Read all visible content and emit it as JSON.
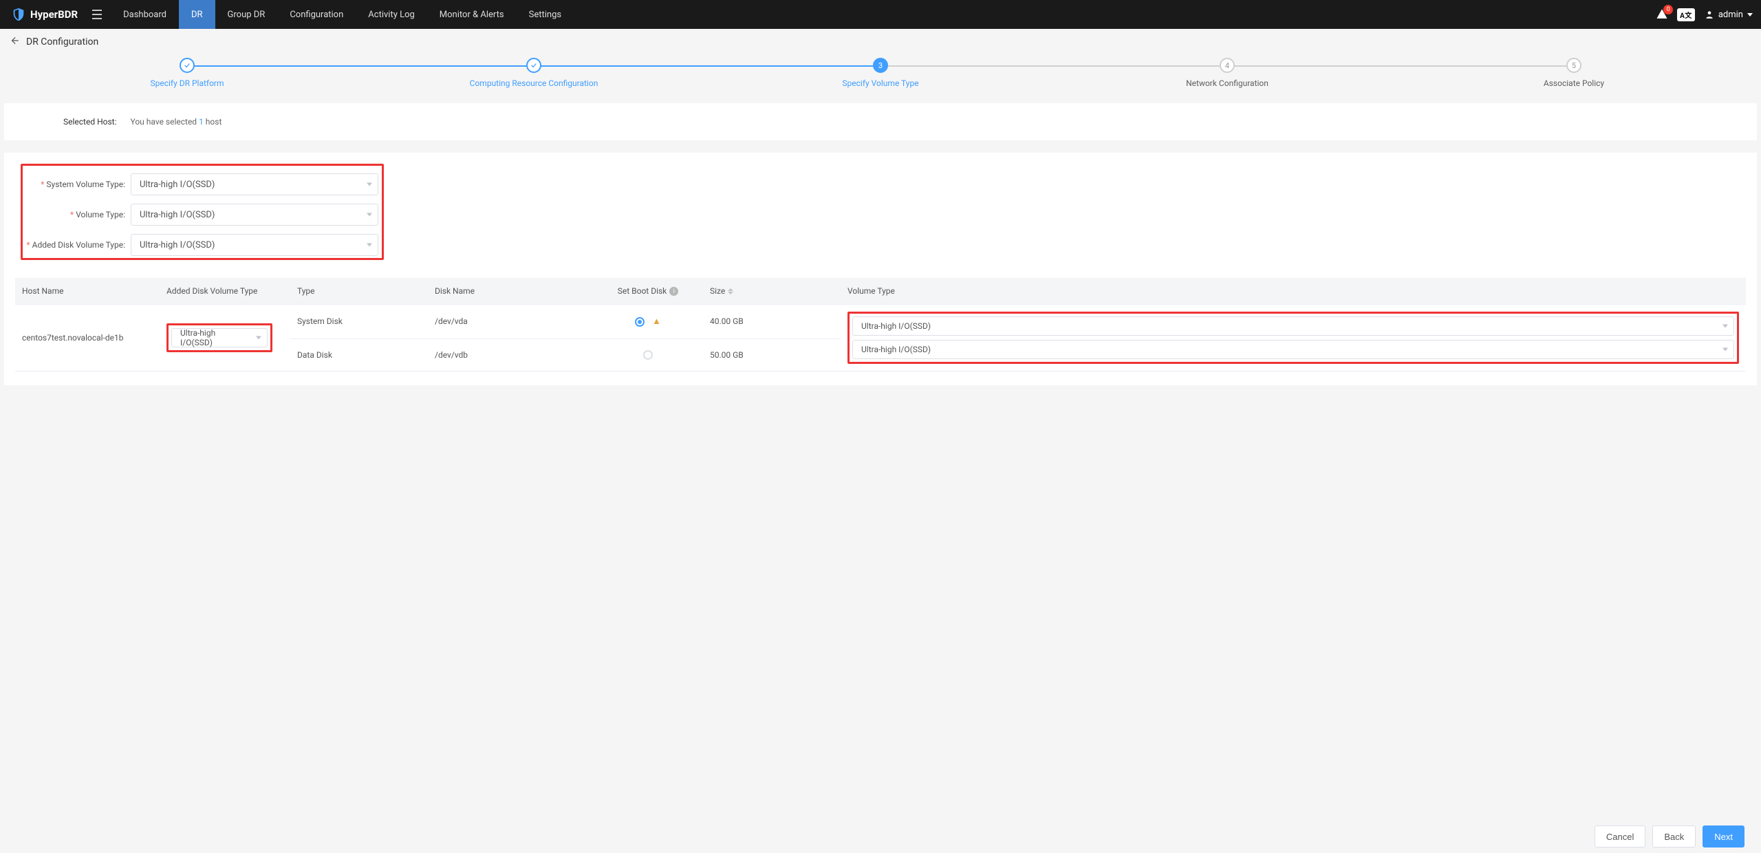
{
  "brand": {
    "name": "HyperBDR"
  },
  "nav": {
    "items": [
      {
        "label": "Dashboard",
        "active": false
      },
      {
        "label": "DR",
        "active": true
      },
      {
        "label": "Group DR",
        "active": false
      },
      {
        "label": "Configuration",
        "active": false
      },
      {
        "label": "Activity Log",
        "active": false
      },
      {
        "label": "Monitor & Alerts",
        "active": false
      },
      {
        "label": "Settings",
        "active": false
      }
    ],
    "alert_badge": "0",
    "lang": "A文",
    "user": "admin"
  },
  "breadcrumb": {
    "title": "DR Configuration"
  },
  "steps": [
    {
      "label": "Specify DR Platform",
      "state": "done",
      "num": "✓"
    },
    {
      "label": "Computing Resource Configuration",
      "state": "done",
      "num": "✓"
    },
    {
      "label": "Specify Volume Type",
      "state": "active",
      "num": "3"
    },
    {
      "label": "Network Configuration",
      "state": "todo",
      "num": "4"
    },
    {
      "label": "Associate Policy",
      "state": "todo",
      "num": "5"
    }
  ],
  "selected_host": {
    "label": "Selected Host:",
    "prefix": "You have selected",
    "count": "1",
    "suffix": "host"
  },
  "form": {
    "system_volume_type": {
      "label": "System Volume Type:",
      "value": "Ultra-high I/O(SSD)"
    },
    "volume_type": {
      "label": "Volume Type:",
      "value": "Ultra-high I/O(SSD)"
    },
    "added_disk_volume_type": {
      "label": "Added Disk Volume Type:",
      "value": "Ultra-high I/O(SSD)"
    }
  },
  "table": {
    "headers": {
      "host_name": "Host Name",
      "added_disk_volume_type": "Added Disk Volume Type",
      "type": "Type",
      "disk_name": "Disk Name",
      "set_boot_disk": "Set Boot Disk",
      "size": "Size",
      "volume_type": "Volume Type"
    },
    "rows": [
      {
        "host_name": "centos7test.novalocal-de1b",
        "added_disk_volume_type": "Ultra-high I/O(SSD)",
        "disks": [
          {
            "type": "System Disk",
            "disk_name": "/dev/vda",
            "boot": true,
            "warn": true,
            "size": "40.00 GB",
            "volume_type": "Ultra-high I/O(SSD)"
          },
          {
            "type": "Data Disk",
            "disk_name": "/dev/vdb",
            "boot": false,
            "warn": false,
            "size": "50.00 GB",
            "volume_type": "Ultra-high I/O(SSD)"
          }
        ]
      }
    ]
  },
  "footer": {
    "cancel": "Cancel",
    "back": "Back",
    "next": "Next"
  }
}
